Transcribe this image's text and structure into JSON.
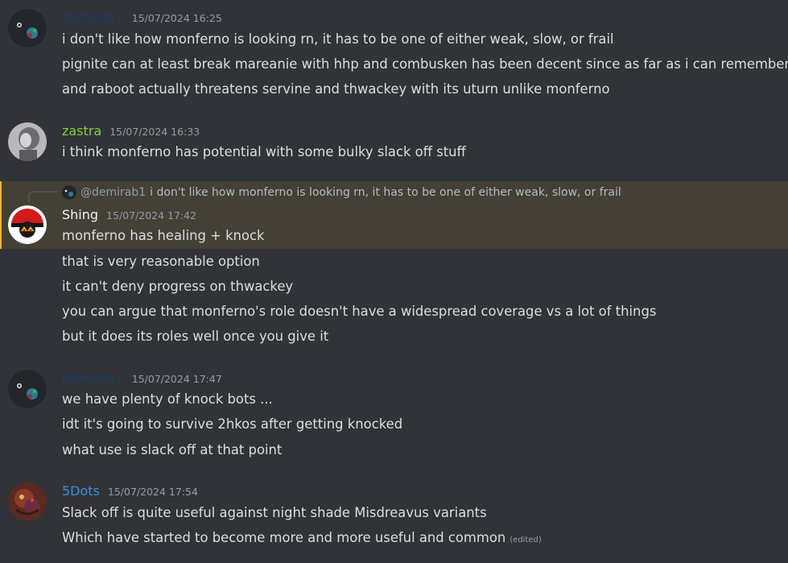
{
  "colors": {
    "background": "#313338",
    "highlight_bg": "#444035",
    "demirab_name": "#1f3d66",
    "zastra_name": "#7fd13b",
    "shing_name": "#f2f3f5",
    "fivedots_name": "#3e8ed0"
  },
  "messages": [
    {
      "author": "demirab1",
      "timestamp": "15/07/2024 16:25",
      "lines": [
        "i don't like how monferno is looking rn, it has to be one of either weak, slow, or frail",
        "pignite can at least break mareanie with hhp and combusken has been decent since as far as i can remember",
        "and raboot actually threatens servine and thwackey with its uturn unlike monferno"
      ]
    },
    {
      "author": "zastra",
      "timestamp": "15/07/2024 16:33",
      "lines": [
        "i think monferno has potential with some bulky slack off stuff"
      ]
    },
    {
      "author": "Shing",
      "timestamp": "15/07/2024 17:42",
      "reply": {
        "mention": "@demirab1",
        "text": "i don't like how monferno is looking rn, it has to be one of either weak, slow, or frail"
      },
      "lines": [
        "monferno has healing + knock",
        "that is very reasonable option",
        "it can't deny progress on thwackey",
        "you can argue that monferno's role doesn't have a widespread coverage vs a lot of things",
        "but it does its roles well once you give it"
      ]
    },
    {
      "author": "demirab1",
      "timestamp": "15/07/2024 17:47",
      "lines": [
        "we have plenty of knock bots ...",
        "idt it's going to survive 2hkos after getting knocked",
        "what use is slack off at that point"
      ]
    },
    {
      "author": "5Dots",
      "timestamp": "15/07/2024 17:54",
      "lines": [
        "Slack off is quite useful against night shade Misdreavus variants",
        "Which have started to become more and more useful and common"
      ],
      "edited_label": "(edited)"
    }
  ]
}
